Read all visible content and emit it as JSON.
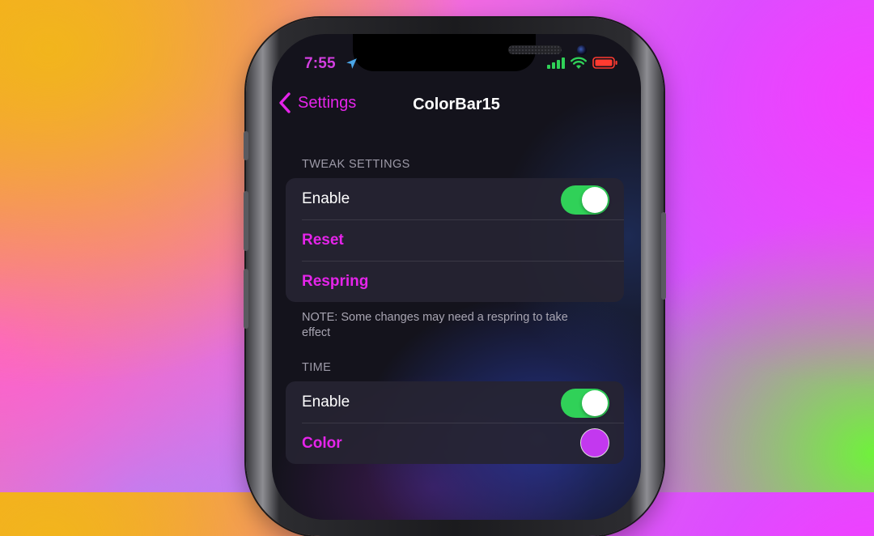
{
  "status_bar": {
    "time": "7:55",
    "location_icon": "location-arrow-icon",
    "signal_icon": "cellular-signal-icon",
    "wifi_icon": "wifi-icon",
    "battery_icon": "battery-low-icon"
  },
  "nav": {
    "back_label": "Settings",
    "back_icon": "chevron-left-icon",
    "title": "ColorBar15"
  },
  "sections": [
    {
      "header": "TWEAK SETTINGS",
      "rows": [
        {
          "label": "Enable",
          "type": "toggle",
          "value": true
        },
        {
          "label": "Reset",
          "type": "action"
        },
        {
          "label": "Respring",
          "type": "action"
        }
      ],
      "footer": "NOTE: Some changes may need a respring to take effect"
    },
    {
      "header": "TIME",
      "rows": [
        {
          "label": "Enable",
          "type": "toggle",
          "value": true
        },
        {
          "label": "Color",
          "type": "color",
          "value": "#c338ef"
        }
      ]
    }
  ],
  "colors": {
    "accent": "#e524ea",
    "toggle_on": "#30d158",
    "battery_red": "#ff3b30",
    "status_green": "#30d158",
    "time_color": "#d23ee0"
  }
}
